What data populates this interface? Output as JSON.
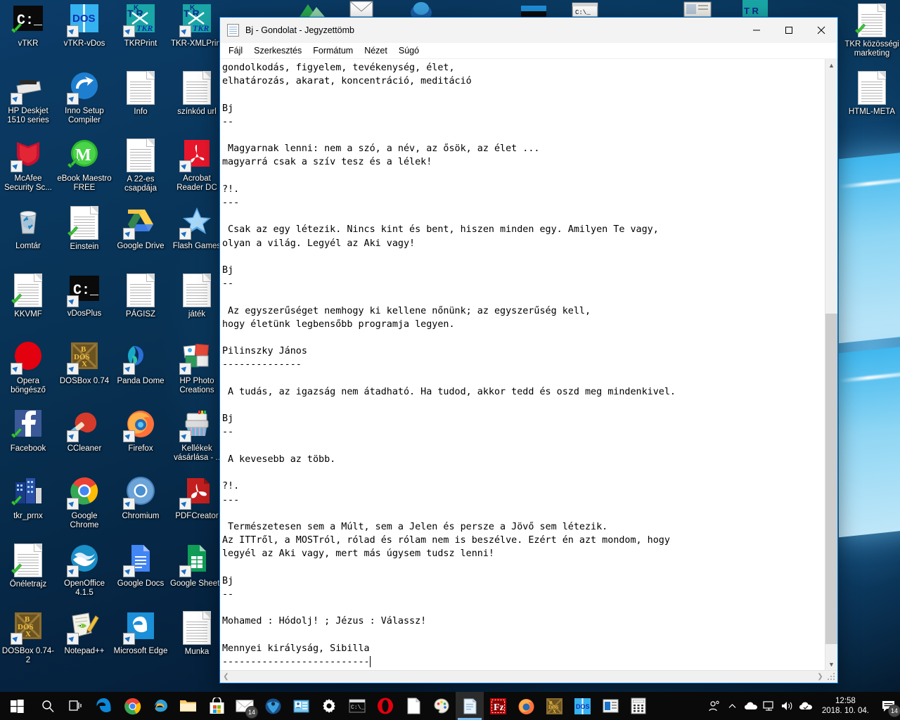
{
  "window": {
    "title": "Bj - Gondolat - Jegyzettömb",
    "icon": "notepad-icon",
    "controls": {
      "minimize": "—",
      "maximize": "☐",
      "close": "✕"
    },
    "menus": [
      "Fájl",
      "Szerkesztés",
      "Formátum",
      "Nézet",
      "Súgó"
    ],
    "document_text": "gondolkodás, figyelem, tevékenység, élet,\nelhatározás, akarat, koncentráció, meditáció\n\nBj\n--\n\n Magyarnak lenni: nem a szó, a név, az ősök, az élet ...\nmagyarrá csak a szív tesz és a lélek!\n\n?!.\n---\n\n Csak az egy létezik. Nincs kint és bent, hiszen minden egy. Amilyen Te vagy,\nolyan a világ. Legyél az Aki vagy!\n\nBj\n--\n\n Az egyszerűséget nemhogy ki kellene nőnünk; az egyszerűség kell,\nhogy életünk legbensőbb programja legyen.\n\nPilinszky János\n--------------\n\n A tudás, az igazság nem átadható. Ha tudod, akkor tedd és oszd meg mindenkivel.\n\nBj\n--\n\n A kevesebb az több.\n\n?!.\n---\n\n Természetesen sem a Múlt, sem a Jelen és persze a Jövő sem létezik.\nAz ITTről, a MOSTról, rólad és rólam nem is beszélve. Ezért én azt mondom, hogy\nlegyél az Aki vagy, mert más úgysem tudsz lenni!\n\nBj\n--\n\nMohamed : Hódolj! ; Jézus : Válassz!\n\nMennyei királyság, Sibilla\n",
    "document_last_line": "--------------------------"
  },
  "desktop": {
    "icons_left": [
      {
        "label": "vTKR",
        "icon": "command-prompt-icon",
        "col": 0,
        "row": 0,
        "checked": true
      },
      {
        "label": "vTKR-vDos",
        "icon": "vdos-icon",
        "col": 1,
        "row": 0,
        "shortcut": true
      },
      {
        "label": "TKRPrint",
        "icon": "tkr-icon",
        "col": 2,
        "row": 0,
        "shortcut": true
      },
      {
        "label": "TKR-XMLPrint",
        "icon": "tkr-icon",
        "col": 3,
        "row": 0,
        "shortcut": true
      },
      {
        "label": "HP Deskjet 1510 series",
        "icon": "printer-icon",
        "col": 0,
        "row": 1,
        "shortcut": true
      },
      {
        "label": "Inno Setup Compiler",
        "icon": "inno-setup-icon",
        "col": 1,
        "row": 1,
        "shortcut": true
      },
      {
        "label": "Info",
        "icon": "text-document-icon",
        "col": 2,
        "row": 1
      },
      {
        "label": "színkód url",
        "icon": "text-document-icon",
        "col": 3,
        "row": 1
      },
      {
        "label": "McAfee Security Sc...",
        "icon": "mcafee-icon",
        "col": 0,
        "row": 2,
        "shortcut": true
      },
      {
        "label": "eBook Maestro FREE",
        "icon": "ebook-maestro-icon",
        "col": 1,
        "row": 2,
        "checked": true
      },
      {
        "label": "A 22-es csapdája",
        "icon": "text-document-icon",
        "col": 2,
        "row": 2
      },
      {
        "label": "Acrobat Reader DC",
        "icon": "acrobat-icon",
        "col": 3,
        "row": 2,
        "shortcut": true
      },
      {
        "label": "Lomtár",
        "icon": "recycle-bin-icon",
        "col": 0,
        "row": 3
      },
      {
        "label": "Einstein",
        "icon": "text-document-icon",
        "col": 1,
        "row": 3,
        "checked": true
      },
      {
        "label": "Google Drive",
        "icon": "google-drive-icon",
        "col": 2,
        "row": 3,
        "shortcut": true
      },
      {
        "label": "Flash Games",
        "icon": "star-icon",
        "col": 3,
        "row": 3,
        "shortcut": true
      },
      {
        "label": "KKVMF",
        "icon": "text-document-icon",
        "col": 0,
        "row": 4,
        "checked": true
      },
      {
        "label": "vDosPlus",
        "icon": "command-prompt-icon",
        "col": 1,
        "row": 4,
        "shortcut": true
      },
      {
        "label": "PÁGISZ",
        "icon": "text-document-icon",
        "col": 2,
        "row": 4
      },
      {
        "label": "játék",
        "icon": "text-document-icon",
        "col": 3,
        "row": 4
      },
      {
        "label": "Opera böngésző",
        "icon": "opera-icon",
        "col": 0,
        "row": 5,
        "shortcut": true
      },
      {
        "label": "DOSBox 0.74",
        "icon": "dosbox-icon",
        "col": 1,
        "row": 5,
        "shortcut": true
      },
      {
        "label": "Panda Dome",
        "icon": "panda-dome-icon",
        "col": 2,
        "row": 5,
        "shortcut": true
      },
      {
        "label": "HP Photo Creations",
        "icon": "hp-photo-icon",
        "col": 3,
        "row": 5,
        "shortcut": true
      },
      {
        "label": "Facebook",
        "icon": "facebook-icon",
        "col": 0,
        "row": 6,
        "checked": true
      },
      {
        "label": "CCleaner",
        "icon": "ccleaner-icon",
        "col": 1,
        "row": 6,
        "shortcut": true
      },
      {
        "label": "Firefox",
        "icon": "firefox-icon",
        "col": 2,
        "row": 6,
        "shortcut": true
      },
      {
        "label": "Kellékek vásárlása - ..",
        "icon": "ink-printer-icon",
        "col": 3,
        "row": 6,
        "shortcut": true
      },
      {
        "label": "tkr_prnx",
        "icon": "city-icon",
        "col": 0,
        "row": 7,
        "checked": true
      },
      {
        "label": "Google Chrome",
        "icon": "chrome-icon",
        "col": 1,
        "row": 7,
        "shortcut": true
      },
      {
        "label": "Chromium",
        "icon": "chromium-icon",
        "col": 2,
        "row": 7,
        "shortcut": true
      },
      {
        "label": "PDFCreator",
        "icon": "pdfcreator-icon",
        "col": 3,
        "row": 7,
        "shortcut": true
      },
      {
        "label": "Önéletrajz",
        "icon": "text-document-icon",
        "col": 0,
        "row": 8,
        "checked": true
      },
      {
        "label": "OpenOffice 4.1.5",
        "icon": "openoffice-icon",
        "col": 1,
        "row": 8,
        "shortcut": true
      },
      {
        "label": "Google Docs",
        "icon": "google-docs-icon",
        "col": 2,
        "row": 8,
        "shortcut": true
      },
      {
        "label": "Google Sheets",
        "icon": "google-sheets-icon",
        "col": 3,
        "row": 8,
        "shortcut": true
      },
      {
        "label": "DOSBox 0.74-2",
        "icon": "dosbox-icon",
        "col": 0,
        "row": 9,
        "shortcut": true
      },
      {
        "label": "Notepad++",
        "icon": "notepad-plus-plus-icon",
        "col": 1,
        "row": 9,
        "shortcut": true
      },
      {
        "label": "Microsoft Edge",
        "icon": "edge-icon",
        "col": 2,
        "row": 9,
        "shortcut": true
      },
      {
        "label": "Munka",
        "icon": "text-document-icon",
        "col": 3,
        "row": 9
      }
    ],
    "icons_right": [
      {
        "label": "TKR közösségi marketing",
        "icon": "text-document-icon",
        "checked": true
      },
      {
        "label": "HTML-META",
        "icon": "text-document-icon"
      }
    ]
  },
  "taskbar": {
    "items": [
      {
        "name": "start-button",
        "icon": "windows-logo-icon"
      },
      {
        "name": "search-button",
        "icon": "search-icon"
      },
      {
        "name": "task-view-button",
        "icon": "task-view-icon"
      },
      {
        "name": "edge-button",
        "icon": "edge-icon"
      },
      {
        "name": "chrome-button",
        "icon": "chrome-icon"
      },
      {
        "name": "internet-explorer-button",
        "icon": "internet-explorer-icon"
      },
      {
        "name": "file-explorer-button",
        "icon": "folder-icon"
      },
      {
        "name": "microsoft-store-button",
        "icon": "store-icon"
      },
      {
        "name": "mail-button",
        "icon": "mail-icon",
        "badge": "14"
      },
      {
        "name": "thunderbird-button",
        "icon": "thunderbird-icon"
      },
      {
        "name": "contacts-button",
        "icon": "contacts-icon"
      },
      {
        "name": "settings-button",
        "icon": "gear-icon"
      },
      {
        "name": "command-prompt-button",
        "icon": "command-prompt-icon"
      },
      {
        "name": "opera-button",
        "icon": "opera-icon"
      },
      {
        "name": "document-button",
        "icon": "text-document-icon"
      },
      {
        "name": "paint-button",
        "icon": "paint-icon"
      },
      {
        "name": "notepad-button",
        "icon": "notepad-icon",
        "active": true
      },
      {
        "name": "filezilla-button",
        "icon": "filezilla-icon"
      },
      {
        "name": "firefox-button",
        "icon": "firefox-icon"
      },
      {
        "name": "dosbox-button",
        "icon": "dosbox-icon"
      },
      {
        "name": "vdos-button",
        "icon": "vdos-icon"
      },
      {
        "name": "news-button",
        "icon": "news-icon"
      },
      {
        "name": "calculator-button",
        "icon": "calculator-icon"
      }
    ],
    "tray": {
      "people_icon": "people-icon",
      "show_hidden_icon": "chevron-up-icon",
      "onedrive_icon": "onedrive-icon",
      "network_icon": "network-icon",
      "volume_icon": "volume-icon",
      "cloud_icon": "cloud-icon",
      "time": "12:58",
      "date": "2018. 10. 04.",
      "notification_icon": "notification-icon",
      "notification_count": "14"
    }
  },
  "colors": {
    "accent": "#0078d7",
    "taskbar": "#0a0a0a",
    "titlebar": "#f3f3f3",
    "desktop_dark": "#062a4e",
    "desktop_light": "#3fb7ee"
  }
}
